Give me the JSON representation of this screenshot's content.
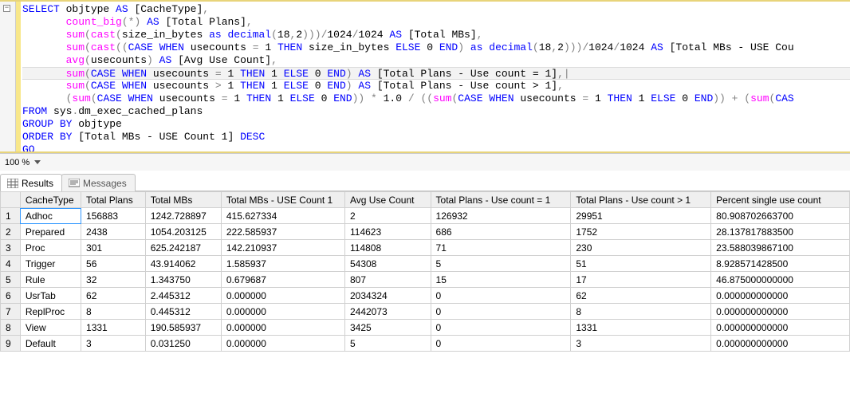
{
  "editor": {
    "collapse_glyph": "−",
    "lines": [
      {
        "html": "<span class='kw'>SELECT</span> objtype <span class='kw'>AS</span> [CacheType]<span class='op'>,</span>"
      },
      {
        "html": "       <span class='fn'>count_big</span><span class='gy'>(</span><span class='op'>*</span><span class='gy'>)</span> <span class='kw'>AS</span> [Total Plans]<span class='op'>,</span>"
      },
      {
        "html": "       <span class='fn'>sum</span><span class='gy'>(</span><span class='fn'>cast</span><span class='gy'>(</span>size_in_bytes <span class='kw'>as</span> <span class='kw'>decimal</span><span class='gy'>(</span>18<span class='op'>,</span>2<span class='gy'>)))</span><span class='op'>/</span>1024<span class='op'>/</span>1024 <span class='kw'>AS</span> [Total MBs]<span class='op'>,</span>"
      },
      {
        "html": "       <span class='fn'>sum</span><span class='gy'>(</span><span class='fn'>cast</span><span class='gy'>((</span><span class='kw'>CASE</span> <span class='kw'>WHEN</span> usecounts <span class='op'>=</span> 1 <span class='kw'>THEN</span> size_in_bytes <span class='kw'>ELSE</span> 0 <span class='kw'>END</span><span class='gy'>)</span> <span class='kw'>as</span> <span class='kw'>decimal</span><span class='gy'>(</span>18<span class='op'>,</span>2<span class='gy'>)))</span><span class='op'>/</span>1024<span class='op'>/</span>1024 <span class='kw'>AS</span> [Total MBs - USE Cou"
      },
      {
        "html": "       <span class='fn'>avg</span><span class='gy'>(</span>usecounts<span class='gy'>)</span> <span class='kw'>AS</span> [Avg Use Count]<span class='op'>,</span>"
      },
      {
        "hl": true,
        "html": "       <span class='fn'>sum</span><span class='gy'>(</span><span class='kw'>CASE</span> <span class='kw'>WHEN</span> usecounts <span class='op'>=</span> 1 <span class='kw'>THEN</span> 1 <span class='kw'>ELSE</span> 0 <span class='kw'>END</span><span class='gy'>)</span> <span class='kw'>AS</span> [Total Plans - Use count = 1]<span class='op'>,|</span>"
      },
      {
        "html": "       <span class='fn'>sum</span><span class='gy'>(</span><span class='kw'>CASE</span> <span class='kw'>WHEN</span> usecounts <span class='op'>&gt;</span> 1 <span class='kw'>THEN</span> 1 <span class='kw'>ELSE</span> 0 <span class='kw'>END</span><span class='gy'>)</span> <span class='kw'>AS</span> [Total Plans - Use count &gt; 1]<span class='op'>,</span>"
      },
      {
        "html": "       <span class='gy'>(</span><span class='fn'>sum</span><span class='gy'>(</span><span class='kw'>CASE</span> <span class='kw'>WHEN</span> usecounts <span class='op'>=</span> 1 <span class='kw'>THEN</span> 1 <span class='kw'>ELSE</span> 0 <span class='kw'>END</span><span class='gy'>))</span> <span class='op'>*</span> 1.0 <span class='op'>/</span> <span class='gy'>((</span><span class='fn'>sum</span><span class='gy'>(</span><span class='kw'>CASE</span> <span class='kw'>WHEN</span> usecounts <span class='op'>=</span> 1 <span class='kw'>THEN</span> 1 <span class='kw'>ELSE</span> 0 <span class='kw'>END</span><span class='gy'>))</span> <span class='op'>+</span> <span class='gy'>(</span><span class='fn'>sum</span><span class='gy'>(</span><span class='kw'>CAS</span>"
      },
      {
        "html": "<span class='kw'>FROM</span> sys<span class='op'>.</span>dm_exec_cached_plans"
      },
      {
        "html": "<span class='kw'>GROUP</span> <span class='kw'>BY</span> objtype"
      },
      {
        "html": "<span class='kw'>ORDER</span> <span class='kw'>BY</span> [Total MBs - USE Count 1] <span class='kw'>DESC</span>"
      },
      {
        "html": "<span class='kw'>GO</span>"
      }
    ]
  },
  "zoom": {
    "value": "100 %"
  },
  "tabs": {
    "results": "Results",
    "messages": "Messages"
  },
  "grid": {
    "headers": [
      "CacheType",
      "Total Plans",
      "Total MBs",
      "Total MBs - USE Count 1",
      "Avg Use Count",
      "Total Plans - Use count = 1",
      "Total Plans - Use count > 1",
      "Percent single use count"
    ],
    "rows": [
      [
        "Adhoc",
        "156883",
        "1242.728897",
        "415.627334",
        "2",
        "126932",
        "29951",
        "80.908702663700"
      ],
      [
        "Prepared",
        "2438",
        "1054.203125",
        "222.585937",
        "114623",
        "686",
        "1752",
        "28.137817883500"
      ],
      [
        "Proc",
        "301",
        "625.242187",
        "142.210937",
        "114808",
        "71",
        "230",
        "23.588039867100"
      ],
      [
        "Trigger",
        "56",
        "43.914062",
        "1.585937",
        "54308",
        "5",
        "51",
        "8.928571428500"
      ],
      [
        "Rule",
        "32",
        "1.343750",
        "0.679687",
        "807",
        "15",
        "17",
        "46.875000000000"
      ],
      [
        "UsrTab",
        "62",
        "2.445312",
        "0.000000",
        "2034324",
        "0",
        "62",
        "0.000000000000"
      ],
      [
        "ReplProc",
        "8",
        "0.445312",
        "0.000000",
        "2442073",
        "0",
        "8",
        "0.000000000000"
      ],
      [
        "View",
        "1331",
        "190.585937",
        "0.000000",
        "3425",
        "0",
        "1331",
        "0.000000000000"
      ],
      [
        "Default",
        "3",
        "0.031250",
        "0.000000",
        "5",
        "0",
        "3",
        "0.000000000000"
      ]
    ]
  },
  "chart_data": {
    "type": "table",
    "columns": [
      "CacheType",
      "Total Plans",
      "Total MBs",
      "Total MBs - USE Count 1",
      "Avg Use Count",
      "Total Plans - Use count = 1",
      "Total Plans - Use count > 1",
      "Percent single use count"
    ],
    "rows": [
      [
        "Adhoc",
        156883,
        1242.728897,
        415.627334,
        2,
        126932,
        29951,
        80.9087026637
      ],
      [
        "Prepared",
        2438,
        1054.203125,
        222.585937,
        114623,
        686,
        1752,
        28.1378178835
      ],
      [
        "Proc",
        301,
        625.242187,
        142.210937,
        114808,
        71,
        230,
        23.5880398671
      ],
      [
        "Trigger",
        56,
        43.914062,
        1.585937,
        54308,
        5,
        51,
        8.9285714285
      ],
      [
        "Rule",
        32,
        1.34375,
        0.679687,
        807,
        15,
        17,
        46.875
      ],
      [
        "UsrTab",
        62,
        2.445312,
        0.0,
        2034324,
        0,
        62,
        0.0
      ],
      [
        "ReplProc",
        8,
        0.445312,
        0.0,
        2442073,
        0,
        8,
        0.0
      ],
      [
        "View",
        1331,
        190.585937,
        0.0,
        3425,
        0,
        1331,
        0.0
      ],
      [
        "Default",
        3,
        0.03125,
        0.0,
        5,
        0,
        3,
        0.0
      ]
    ]
  }
}
